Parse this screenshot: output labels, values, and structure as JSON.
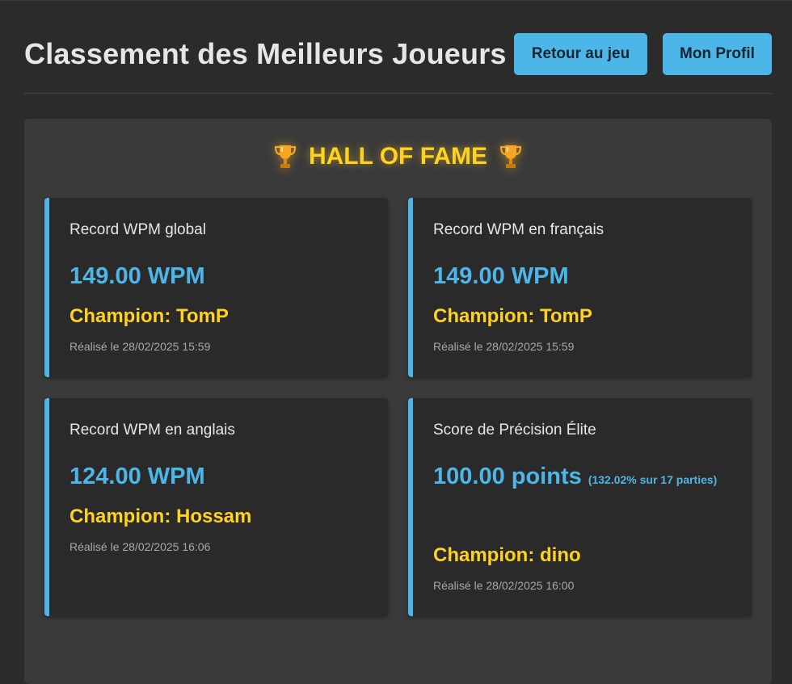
{
  "header": {
    "title": "Classement des Meilleurs Joueurs",
    "back_label": "Retour au jeu",
    "profile_label": "Mon Profil"
  },
  "hall_of_fame": {
    "title": "HALL OF FAME",
    "icon": "trophy-icon",
    "cards": [
      {
        "label": "Record WPM global",
        "value": "149.00 WPM",
        "detail": "",
        "champion": "Champion: TomP",
        "date": "Réalisé le 28/02/2025 15:59"
      },
      {
        "label": "Record WPM en français",
        "value": "149.00 WPM",
        "detail": "",
        "champion": "Champion: TomP",
        "date": "Réalisé le 28/02/2025 15:59"
      },
      {
        "label": "Record WPM en anglais",
        "value": "124.00 WPM",
        "detail": "",
        "champion": "Champion: Hossam",
        "date": "Réalisé le 28/02/2025 16:06"
      },
      {
        "label": "Score de Précision Élite",
        "value": "100.00 points",
        "detail": "(132.02% sur 17 parties)",
        "champion": "Champion: dino",
        "date": "Réalisé le 28/02/2025 16:00"
      }
    ]
  },
  "colors": {
    "background": "#2b2b2b",
    "panel": "#3a3a3a",
    "card": "#2a2a2a",
    "accent_blue": "#4db6e8",
    "accent_gold": "#ffd21f",
    "muted_text": "#a9a9a9"
  }
}
